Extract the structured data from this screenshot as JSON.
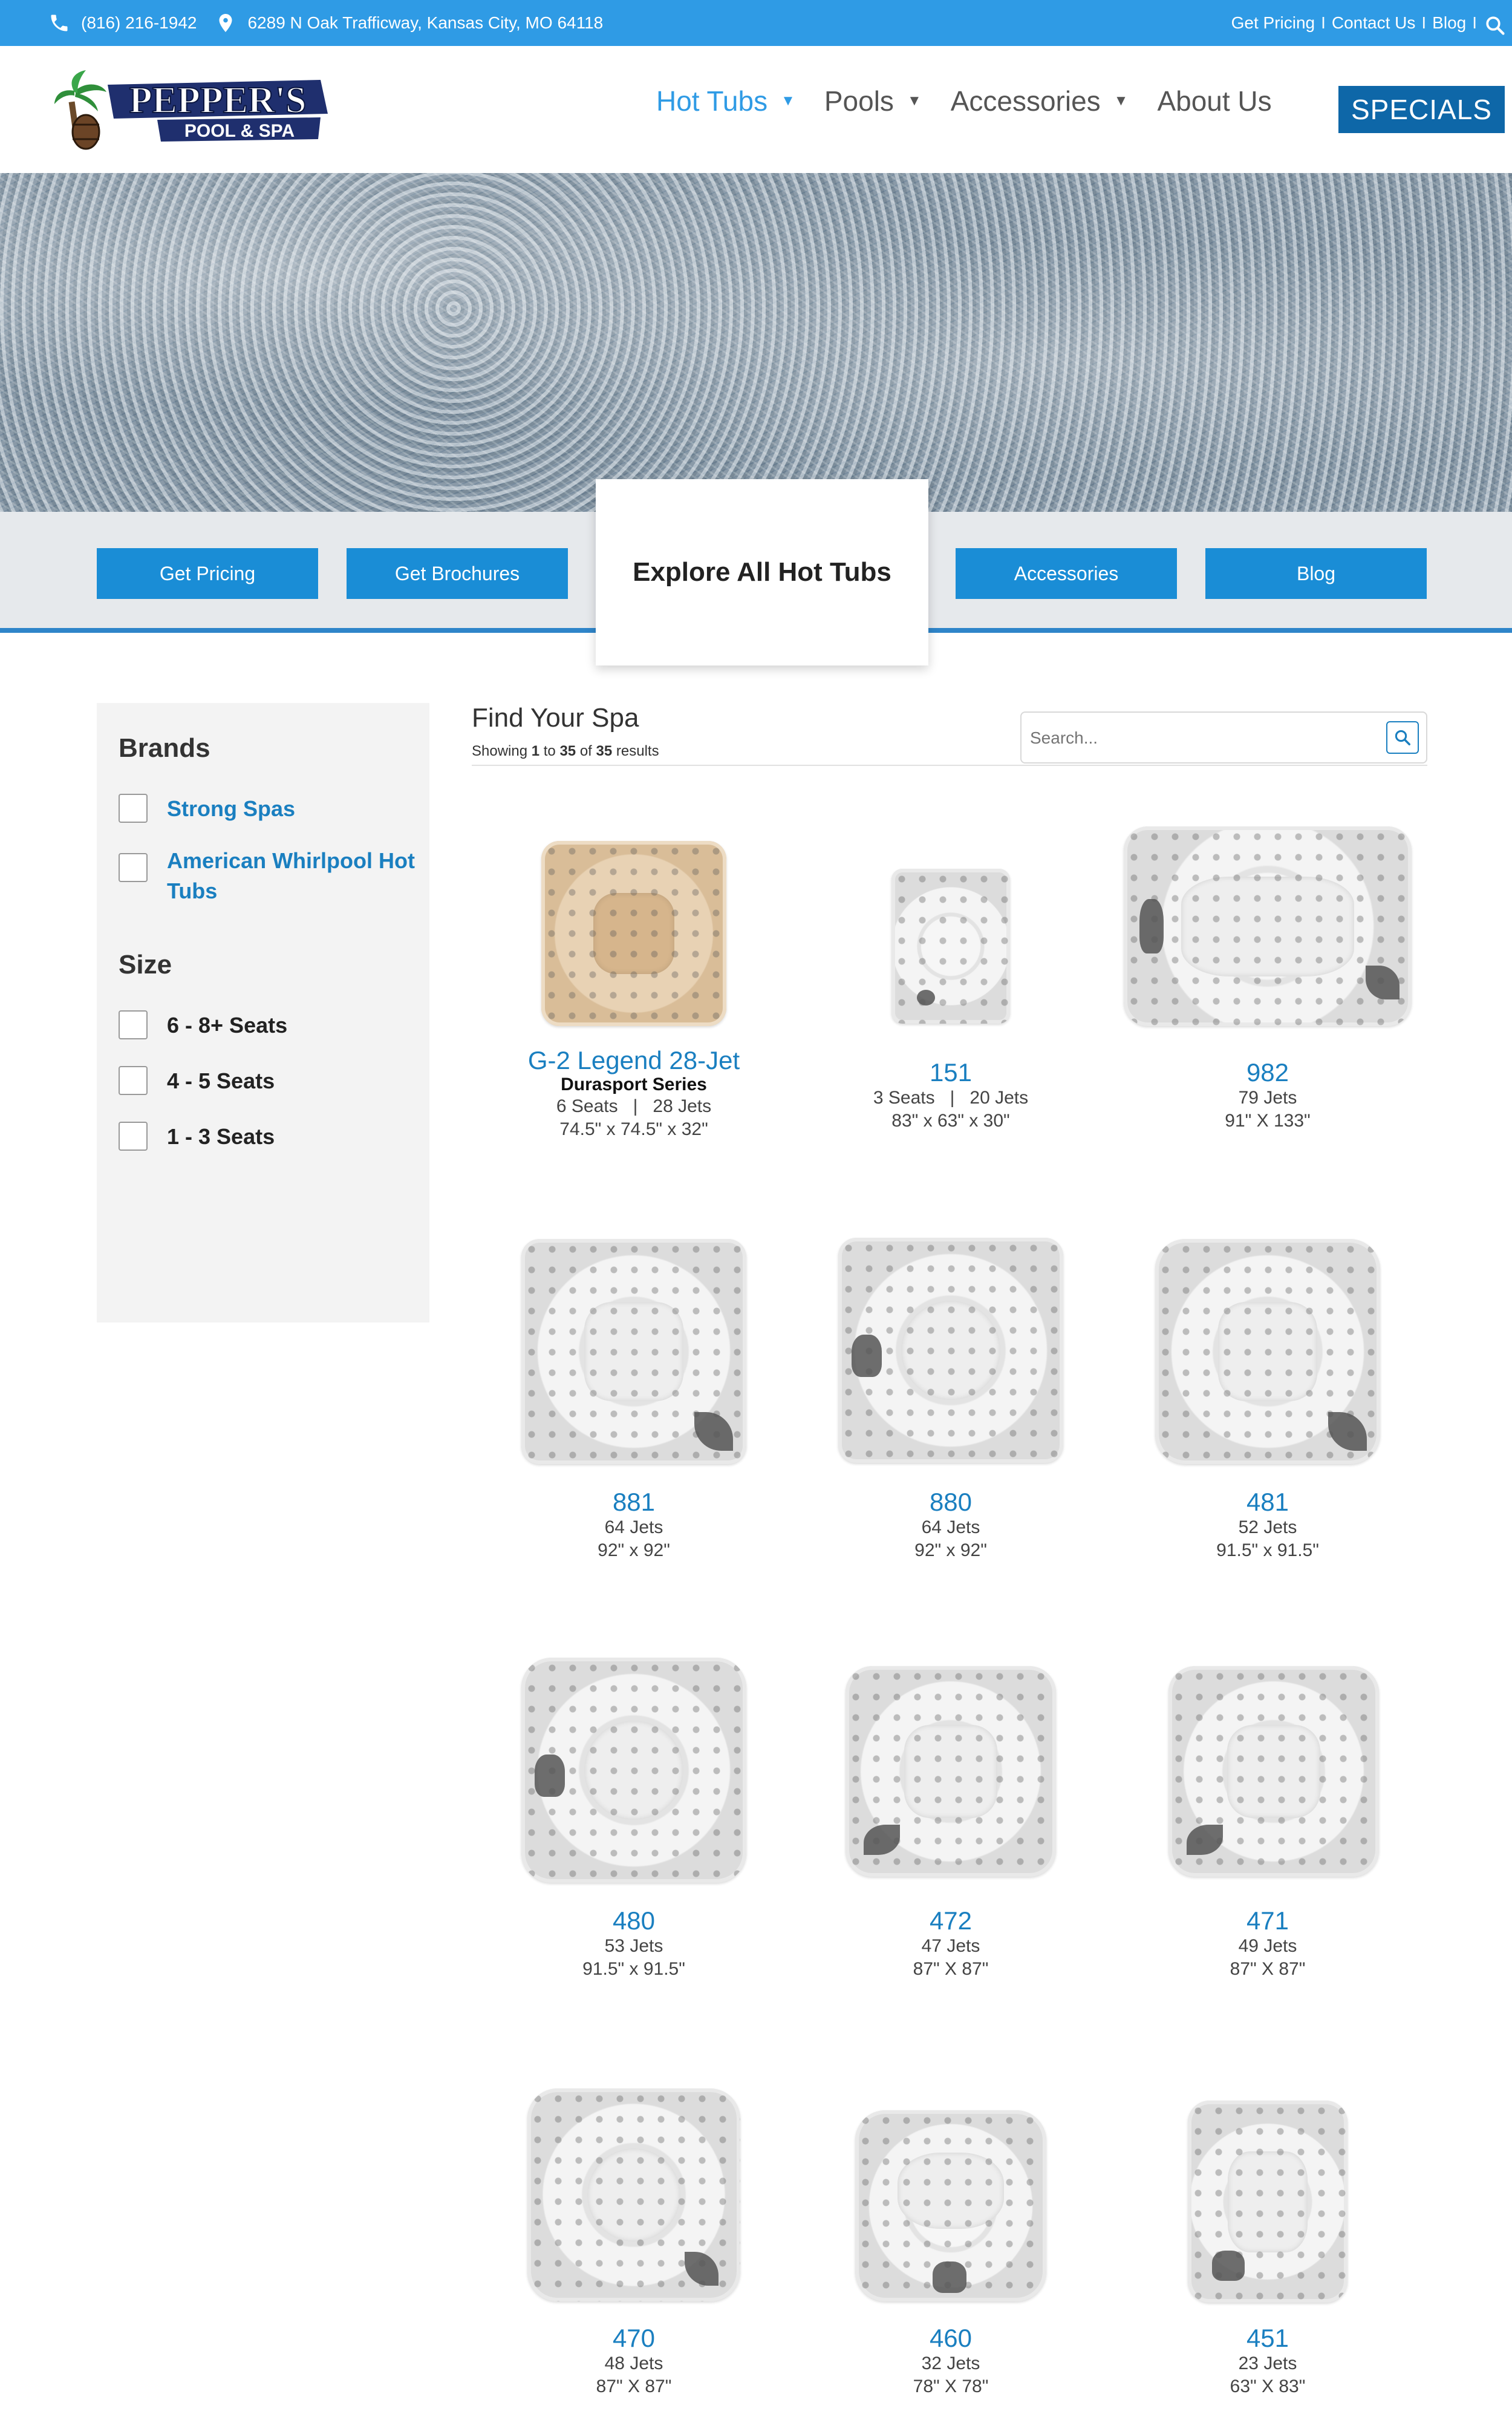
{
  "topbar": {
    "phone": "(816) 216-1942",
    "address": "6289 N Oak Trafficway, Kansas City, MO 64118",
    "links": [
      "Get Pricing",
      "Contact Us",
      "Blog"
    ],
    "separators": [
      "I",
      "I",
      "I"
    ]
  },
  "header": {
    "logo_name": "PEPPER'S",
    "logo_sub": "POOL & SPA",
    "nav": [
      "Hot Tubs",
      "Pools",
      "Accessories",
      "About Us"
    ],
    "specials": "SPECIALS"
  },
  "strip": {
    "buttons": [
      "Get Pricing",
      "Get Brochures",
      "Accessories",
      "Blog"
    ],
    "explore": "Explore All Hot Tubs"
  },
  "sidebar": {
    "brands_title": "Brands",
    "brands": [
      "Strong Spas",
      "American Whirlpool Hot Tubs"
    ],
    "size_title": "Size",
    "sizes": [
      "6 - 8+ Seats",
      "4 - 5 Seats",
      "1 - 3 Seats"
    ]
  },
  "results": {
    "title": "Find Your Spa",
    "showing_prefix": "Showing",
    "from": "1",
    "to_word": "to",
    "to": "35",
    "of_word": "of",
    "total": "35",
    "suffix": "results",
    "search_placeholder": "Search..."
  },
  "products": [
    {
      "name": "G-2 Legend 28-Jet",
      "series": "Durasport Series",
      "spec1": "6 Seats   |   28 Jets",
      "spec2": "74.5\" x 74.5\" x 32\""
    },
    {
      "name": "151",
      "series": "",
      "spec1": "3 Seats   |   20 Jets",
      "spec2": "83\" x 63\" x 30\""
    },
    {
      "name": "982",
      "series": "",
      "spec1": "79 Jets",
      "spec2": "91\" X 133\""
    },
    {
      "name": "881",
      "series": "",
      "spec1": "64 Jets",
      "spec2": "92\" x 92\""
    },
    {
      "name": "880",
      "series": "",
      "spec1": "64 Jets",
      "spec2": "92\" x 92\""
    },
    {
      "name": "481",
      "series": "",
      "spec1": "52 Jets",
      "spec2": "91.5\" x 91.5\""
    },
    {
      "name": "480",
      "series": "",
      "spec1": "53 Jets",
      "spec2": "91.5\" x 91.5\""
    },
    {
      "name": "472",
      "series": "",
      "spec1": "47 Jets",
      "spec2": "87\" X 87\""
    },
    {
      "name": "471",
      "series": "",
      "spec1": "49 Jets",
      "spec2": "87\" X 87\""
    },
    {
      "name": "470",
      "series": "",
      "spec1": "48 Jets",
      "spec2": "87\" X 87\""
    },
    {
      "name": "460",
      "series": "",
      "spec1": "32 Jets",
      "spec2": "78\" X 78\""
    },
    {
      "name": "451",
      "series": "",
      "spec1": "23 Jets",
      "spec2": "63\" X 83\""
    }
  ],
  "colors": {
    "topbar": "#2f9be5",
    "accent_blue": "#1a7fc0",
    "button_blue": "#1a8dd6",
    "specials_bg": "#0e67a8"
  }
}
